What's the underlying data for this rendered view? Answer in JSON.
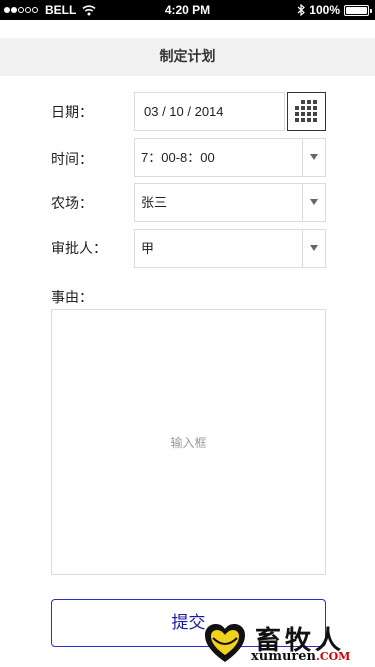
{
  "status_bar": {
    "carrier": "BELL",
    "time": "4:20 PM",
    "battery": "100%"
  },
  "nav": {
    "title": "制定计划"
  },
  "form": {
    "date_label": "日期：",
    "date_value": "03 / 10 / 2014",
    "time_label": "时间：",
    "time_value": "7：00-8：00",
    "farm_label": "农场：",
    "farm_value": "张三",
    "approver_label": "审批人：",
    "approver_value": "甲",
    "reason_label": "事由：",
    "reason_placeholder": "输入框",
    "submit_label": "提交"
  },
  "watermark": {
    "brand": "畜牧人",
    "url_main": "xumuren",
    "url_suffix": ".COM"
  },
  "colors": {
    "accent": "#1a1aa8",
    "border": "#dcdcdc",
    "nav_bg": "#f2f2f2"
  }
}
